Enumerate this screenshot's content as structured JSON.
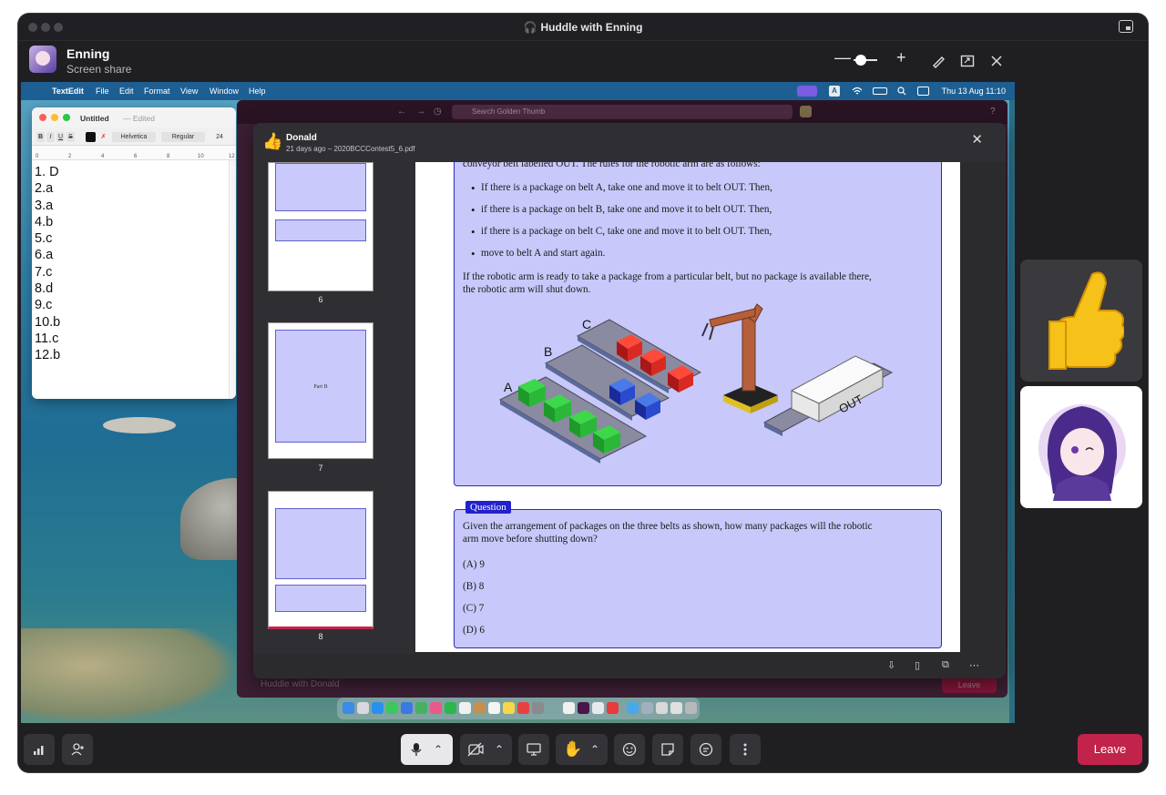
{
  "window": {
    "title": "Huddle with Enning",
    "title_icon": "headphones-icon"
  },
  "sharer": {
    "name": "Enning",
    "subtitle": "Screen share"
  },
  "header_controls": {
    "zoom_out": "—",
    "zoom_in": "+"
  },
  "mac_menubar": {
    "app": "TextEdit",
    "items": [
      "File",
      "Edit",
      "Format",
      "View",
      "Window",
      "Help"
    ],
    "clock": "Thu 13 Aug  11:10",
    "input_indicator": "A"
  },
  "textedit": {
    "title": "Untitled",
    "edited": "— Edited",
    "font": "Helvetica",
    "style": "Regular",
    "size": "24",
    "ruler_numbers": [
      "0",
      "2",
      "4",
      "6",
      "8",
      "10",
      "12"
    ],
    "answers": [
      "1. D",
      "2.a",
      "3.a",
      "4.b",
      "5.c",
      "6.a",
      "7.c",
      "8.d",
      "9.c",
      "10.b",
      "11.c",
      "12.b"
    ]
  },
  "slack": {
    "search_placeholder": "Search Golden Thumb",
    "bottom_huddle": "Huddle with Donald",
    "leave": "Leave"
  },
  "viewer": {
    "sender": "Donald",
    "meta": "21 days ago – 2020BCCContest5_6.pdf",
    "thumb_labels": [
      "6",
      "7",
      "8"
    ],
    "part_label": "Part B"
  },
  "pdf": {
    "intro_cut": "conveyor belt labelled OUT. The rules for the robotic arm are as follows:",
    "rules": [
      "If there is a package on belt A, take one and move it to belt OUT. Then,",
      "if there is a package on belt B, take one and move it to belt OUT. Then,",
      "if there is a package on belt C, take one and move it to belt OUT. Then,",
      "move to belt A and start again."
    ],
    "shutdown_line1": "If the robotic arm is ready to take a package from a particular belt, but no package is available there,",
    "shutdown_line2": "the robotic arm will shut down.",
    "belt_labels": {
      "a": "A",
      "b": "B",
      "c": "C",
      "out": "OUT"
    },
    "question_tag": "Question",
    "question_line1": "Given the arrangement of packages on the three belts as shown, how many packages will the robotic",
    "question_line2": "arm move before shutting down?",
    "options": [
      "(A)  9",
      "(B)  8",
      "(C)  7",
      "(D)  6"
    ]
  },
  "toolbar": {
    "leave": "Leave"
  },
  "colors": {
    "leave": "#c2234a",
    "pdf_box": "#c8c8fa",
    "pdf_border": "#2c2cbb",
    "slack": "#3b1f33"
  }
}
